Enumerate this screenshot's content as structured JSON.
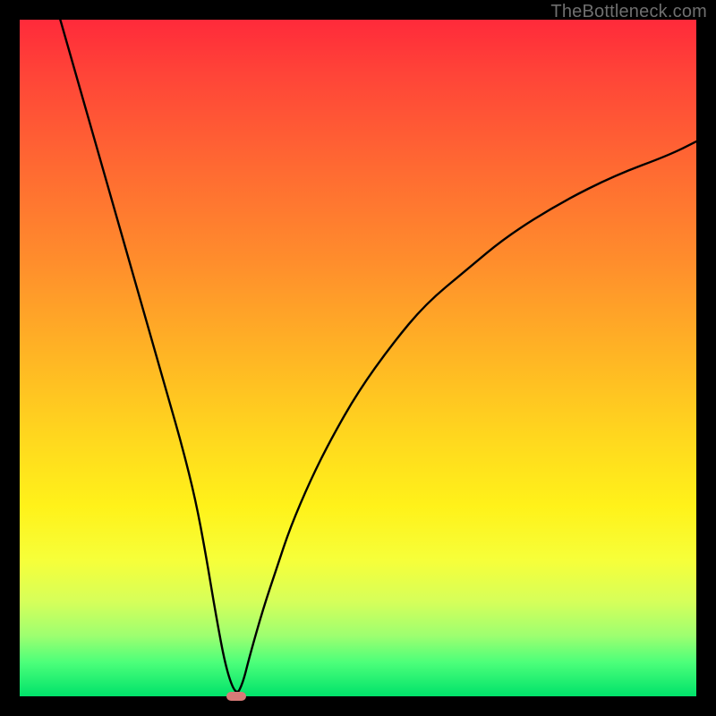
{
  "watermark": "TheBottleneck.com",
  "chart_data": {
    "type": "line",
    "title": "",
    "xlabel": "",
    "ylabel": "",
    "xlim": [
      0,
      100
    ],
    "ylim": [
      0,
      100
    ],
    "grid": false,
    "legend": false,
    "background_gradient": {
      "top": "#ff2a3a",
      "bottom": "#00e26a",
      "stops": [
        "red",
        "orange",
        "yellow",
        "green"
      ]
    },
    "series": [
      {
        "name": "bottleneck-curve",
        "color": "#000000",
        "x": [
          6,
          8,
          10,
          12,
          14,
          16,
          18,
          20,
          22,
          24,
          26,
          27.5,
          29,
          30.5,
          32,
          33,
          34,
          36,
          38,
          40,
          43,
          46,
          50,
          55,
          60,
          66,
          72,
          80,
          88,
          96,
          100
        ],
        "y": [
          100,
          93,
          86,
          79,
          72,
          65,
          58,
          51,
          44,
          37,
          29,
          21,
          12,
          4,
          0,
          2,
          6,
          13,
          19,
          25,
          32,
          38,
          45,
          52,
          58,
          63,
          68,
          73,
          77,
          80,
          82
        ]
      }
    ],
    "marker": {
      "x": 32,
      "y": 0,
      "color": "#d87a78"
    }
  }
}
